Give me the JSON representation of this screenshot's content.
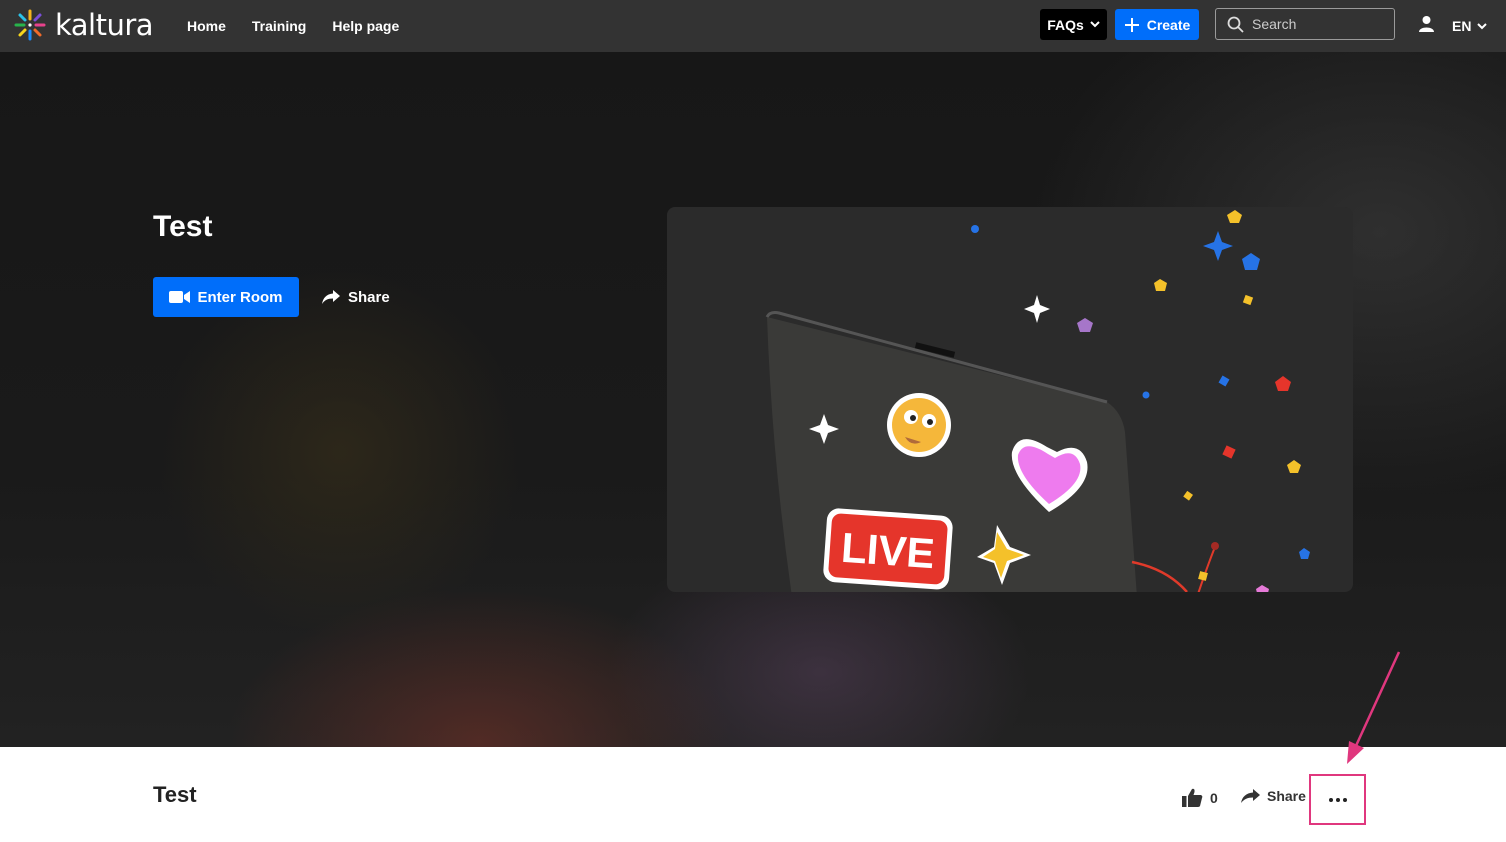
{
  "brand": {
    "name": "kaltura"
  },
  "nav": {
    "items": [
      "Home",
      "Training",
      "Help page"
    ]
  },
  "header": {
    "faqs_label": "FAQs",
    "create_label": "Create",
    "search_placeholder": "Search",
    "language": "EN"
  },
  "hero": {
    "title": "Test",
    "enter_room_label": "Enter Room",
    "share_label": "Share",
    "thumbnail": {
      "badge_text": "LIVE"
    }
  },
  "entry": {
    "title": "Test",
    "like_count": "0",
    "share_label": "Share",
    "more_label": "..."
  },
  "colors": {
    "topbar": "#333333",
    "accent": "#006efa",
    "highlight": "#e0377e"
  }
}
